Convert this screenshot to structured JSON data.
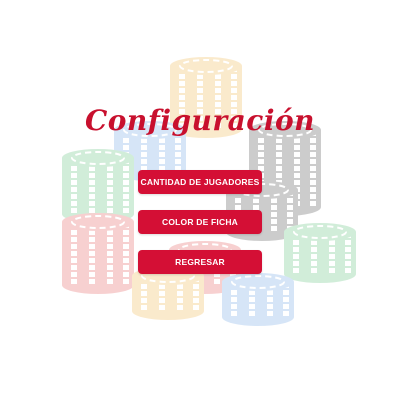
{
  "screen": {
    "title": "Configuración",
    "accent_color": "#d40f35",
    "background_image": "poker-chip-stacks"
  },
  "menu": {
    "players_button": "CANTIDAD DE JUGADORES",
    "chip_color_button": "COLOR DE FICHA",
    "back_button": "REGRESAR"
  },
  "chip_stacks": [
    {
      "color": "#f0b54a",
      "name": "yellow-chip-stack"
    },
    {
      "color": "#6fa6e6",
      "name": "blue-chip-stack"
    },
    {
      "color": "#4a4a4a",
      "name": "black-chip-stack"
    },
    {
      "color": "#5cbf7a",
      "name": "green-chip-stack"
    },
    {
      "color": "#e45a5a",
      "name": "red-chip-stack"
    }
  ]
}
